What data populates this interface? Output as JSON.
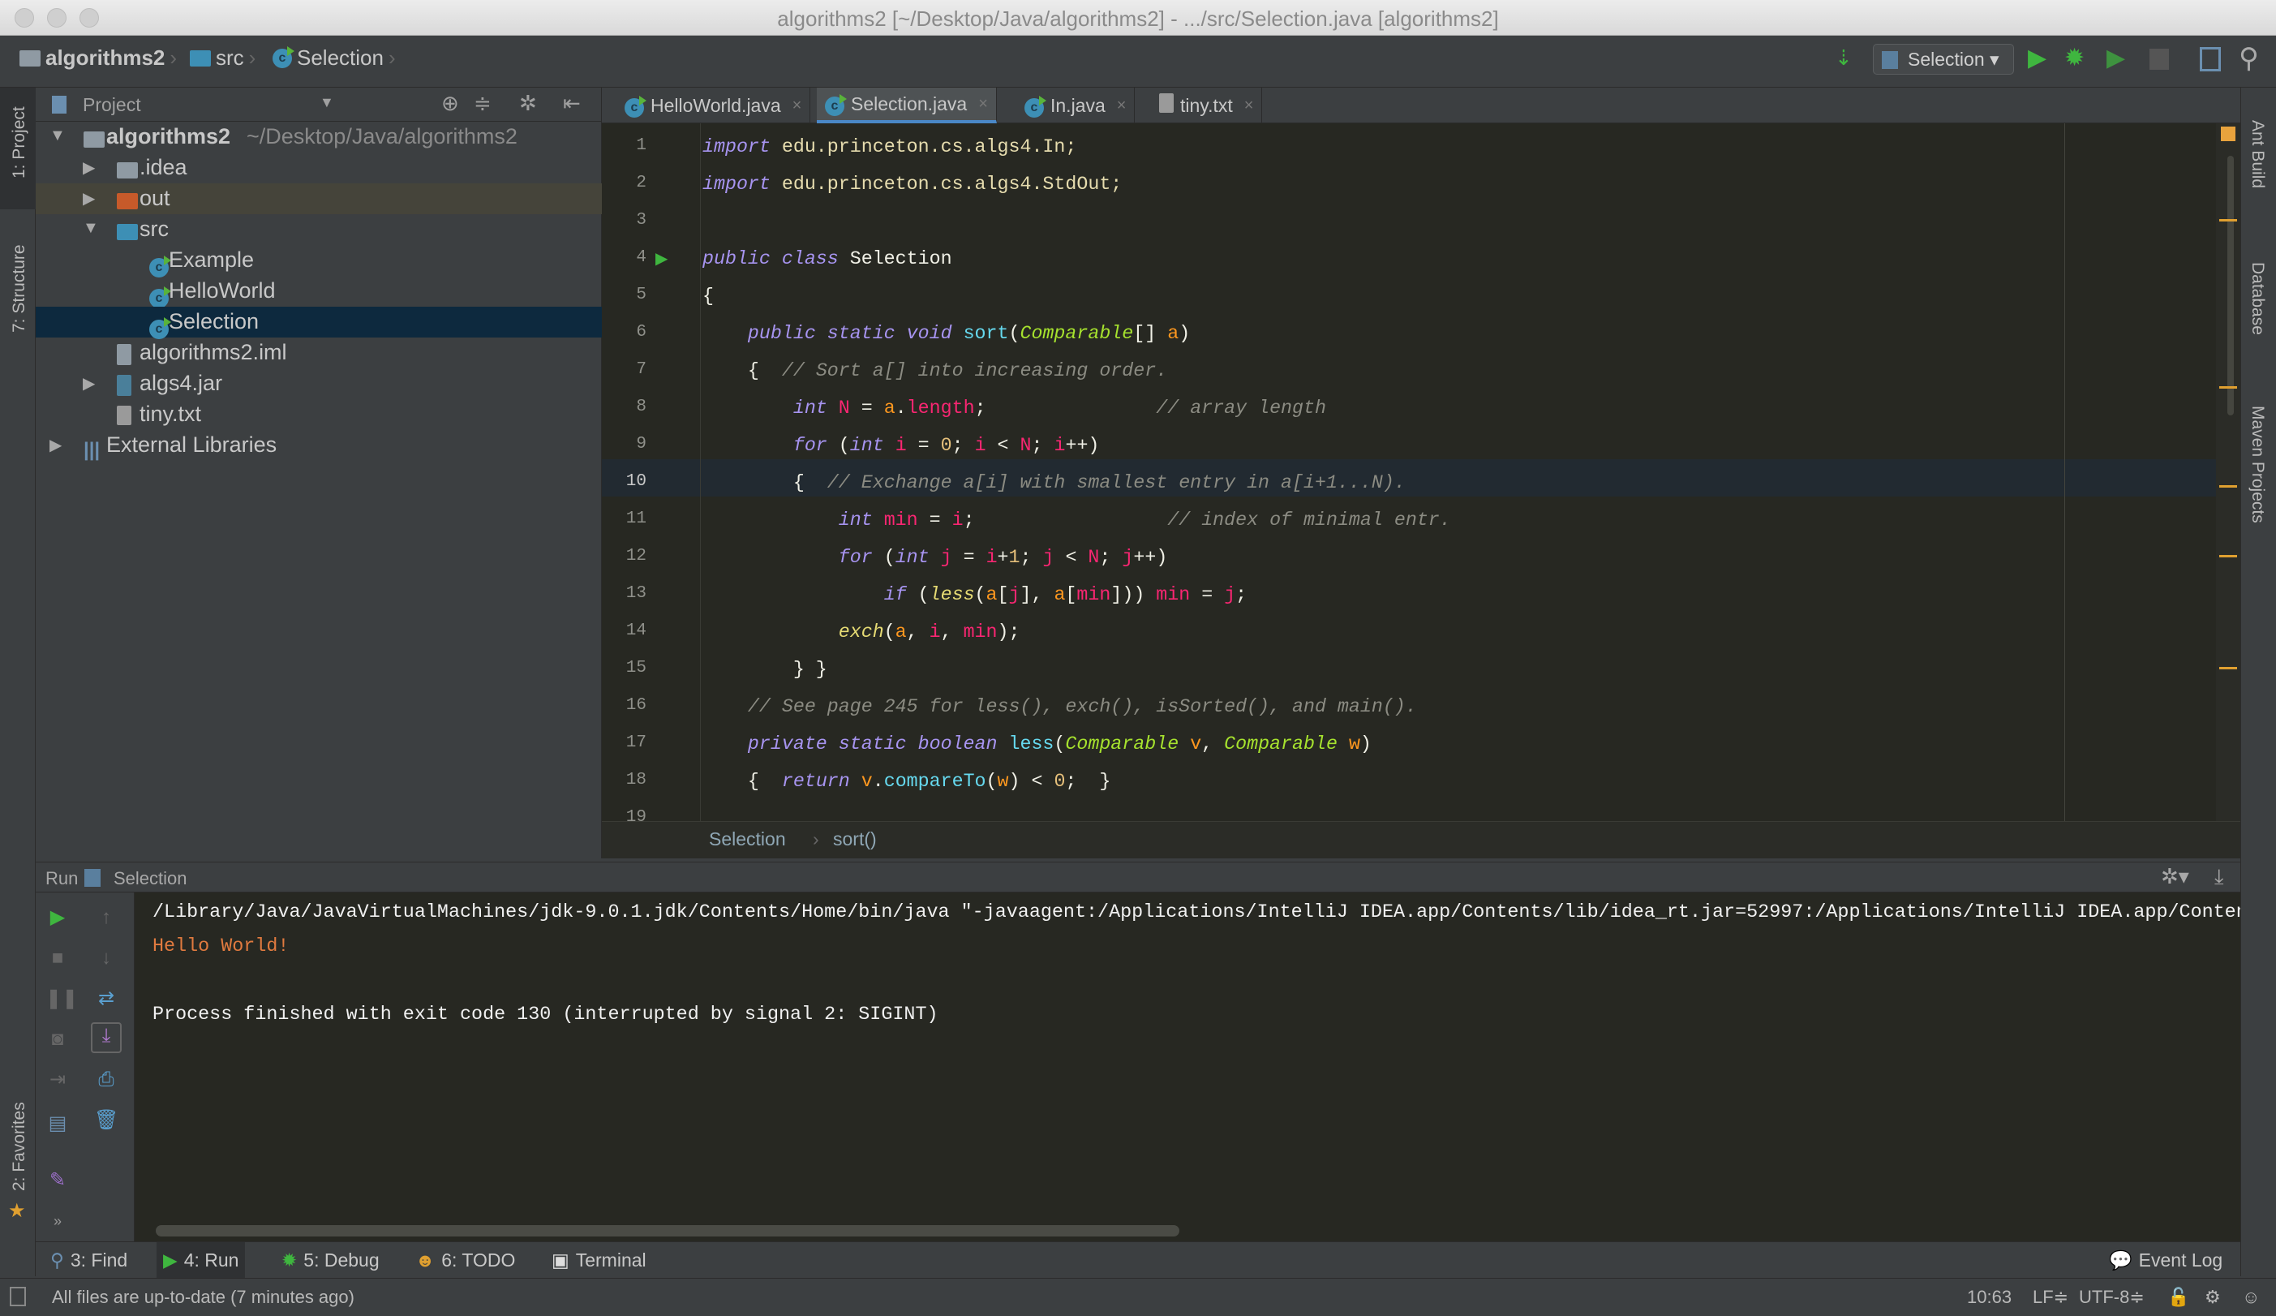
{
  "window": {
    "title": "algorithms2 [~/Desktop/Java/algorithms2] - .../src/Selection.java [algorithms2]"
  },
  "navbar": {
    "breadcrumbs": [
      "algorithms2",
      "src",
      "Selection"
    ],
    "run_config": "Selection",
    "icons": [
      "build-icon",
      "run-icon",
      "debug-icon",
      "coverage-icon",
      "stop-icon",
      "project-structure-icon",
      "search-icon"
    ]
  },
  "left_strip": {
    "project": "1: Project",
    "structure": "7: Structure",
    "favorites": "2: Favorites"
  },
  "right_strip": {
    "ant": "Ant Build",
    "database": "Database",
    "maven": "Maven Projects"
  },
  "project": {
    "header": "Project",
    "tree": [
      {
        "label": "algorithms2",
        "path": "~/Desktop/Java/algorithms2",
        "level": 0,
        "arrow": "▼",
        "icon": "module"
      },
      {
        "label": ".idea",
        "level": 1,
        "arrow": "▶",
        "icon": "folder"
      },
      {
        "label": "out",
        "level": 1,
        "arrow": "▶",
        "icon": "folder-orange"
      },
      {
        "label": "src",
        "level": 1,
        "arrow": "▼",
        "icon": "folder-blue"
      },
      {
        "label": "Example",
        "level": 2,
        "icon": "class"
      },
      {
        "label": "HelloWorld",
        "level": 2,
        "icon": "class"
      },
      {
        "label": "Selection",
        "level": 2,
        "icon": "class",
        "selected": true
      },
      {
        "label": "algorithms2.iml",
        "level": 1,
        "icon": "file"
      },
      {
        "label": "algs4.jar",
        "level": 1,
        "arrow": "▶",
        "icon": "jar"
      },
      {
        "label": "tiny.txt",
        "level": 1,
        "icon": "text"
      },
      {
        "label": "External Libraries",
        "level": 0,
        "arrow": "▶",
        "icon": "libraries"
      }
    ]
  },
  "tabs": [
    {
      "label": "HelloWorld.java",
      "icon": "class"
    },
    {
      "label": "Selection.java",
      "icon": "class",
      "active": true
    },
    {
      "label": "In.java",
      "icon": "class-locked"
    },
    {
      "label": "tiny.txt",
      "icon": "text"
    }
  ],
  "editor": {
    "current_line": 10,
    "lines": [
      [
        [
          "k",
          "import"
        ],
        [
          "pk",
          " edu.princeton.cs.algs4.In;"
        ]
      ],
      [
        [
          "k",
          "import"
        ],
        [
          "pk",
          " edu.princeton.cs.algs4.StdOut;"
        ]
      ],
      [],
      [
        [
          "k",
          "public class"
        ],
        [
          "p",
          " Selection"
        ]
      ],
      [
        [
          "p",
          "{"
        ]
      ],
      [
        [
          "p",
          "    "
        ],
        [
          "k",
          "public static void"
        ],
        [
          "p",
          " "
        ],
        [
          "m",
          "sort"
        ],
        [
          "p",
          "("
        ],
        [
          "t",
          "Comparable"
        ],
        [
          "p",
          "[] "
        ],
        [
          "a",
          "a"
        ],
        [
          "p",
          ")"
        ]
      ],
      [
        [
          "p",
          "    {  "
        ],
        [
          "c",
          "// Sort a[] into increasing order."
        ]
      ],
      [
        [
          "p",
          "        "
        ],
        [
          "k",
          "int"
        ],
        [
          "p",
          " "
        ],
        [
          "v",
          "N"
        ],
        [
          "p",
          " = "
        ],
        [
          "a",
          "a"
        ],
        [
          "p",
          "."
        ],
        [
          "v",
          "length"
        ],
        [
          "p",
          ";               "
        ],
        [
          "c",
          "// array length"
        ]
      ],
      [
        [
          "p",
          "        "
        ],
        [
          "k",
          "for"
        ],
        [
          "p",
          " ("
        ],
        [
          "k",
          "int"
        ],
        [
          "p",
          " "
        ],
        [
          "v",
          "i"
        ],
        [
          "p",
          " = "
        ],
        [
          "n",
          "0"
        ],
        [
          "p",
          "; "
        ],
        [
          "v",
          "i"
        ],
        [
          "p",
          " < "
        ],
        [
          "v",
          "N"
        ],
        [
          "p",
          "; "
        ],
        [
          "v",
          "i"
        ],
        [
          "p",
          "++)"
        ]
      ],
      [
        [
          "p",
          "        {  "
        ],
        [
          "c",
          "// Exchange a[i] with smallest entry in a[i+1...N)."
        ]
      ],
      [
        [
          "p",
          "            "
        ],
        [
          "k",
          "int"
        ],
        [
          "p",
          " "
        ],
        [
          "v",
          "min"
        ],
        [
          "p",
          " = "
        ],
        [
          "v",
          "i"
        ],
        [
          "p",
          ";                 "
        ],
        [
          "c",
          "// index of minimal entr."
        ]
      ],
      [
        [
          "p",
          "            "
        ],
        [
          "k",
          "for"
        ],
        [
          "p",
          " ("
        ],
        [
          "k",
          "int"
        ],
        [
          "p",
          " "
        ],
        [
          "v",
          "j"
        ],
        [
          "p",
          " = "
        ],
        [
          "v",
          "i"
        ],
        [
          "p",
          "+"
        ],
        [
          "n",
          "1"
        ],
        [
          "p",
          "; "
        ],
        [
          "v",
          "j"
        ],
        [
          "p",
          " < "
        ],
        [
          "v",
          "N"
        ],
        [
          "p",
          "; "
        ],
        [
          "v",
          "j"
        ],
        [
          "p",
          "++)"
        ]
      ],
      [
        [
          "p",
          "                "
        ],
        [
          "k",
          "if"
        ],
        [
          "p",
          " ("
        ],
        [
          "s",
          "less"
        ],
        [
          "p",
          "("
        ],
        [
          "a",
          "a"
        ],
        [
          "p",
          "["
        ],
        [
          "v",
          "j"
        ],
        [
          "p",
          "], "
        ],
        [
          "a",
          "a"
        ],
        [
          "p",
          "["
        ],
        [
          "v",
          "min"
        ],
        [
          "p",
          "])) "
        ],
        [
          "v",
          "min"
        ],
        [
          "p",
          " = "
        ],
        [
          "v",
          "j"
        ],
        [
          "p",
          ";"
        ]
      ],
      [
        [
          "p",
          "            "
        ],
        [
          "s",
          "exch"
        ],
        [
          "p",
          "("
        ],
        [
          "a",
          "a"
        ],
        [
          "p",
          ", "
        ],
        [
          "v",
          "i"
        ],
        [
          "p",
          ", "
        ],
        [
          "v",
          "min"
        ],
        [
          "p",
          ");"
        ]
      ],
      [
        [
          "p",
          "        } }"
        ]
      ],
      [
        [
          "p",
          "    "
        ],
        [
          "c",
          "// See page 245 for less(), exch(), isSorted(), and main()."
        ]
      ],
      [
        [
          "p",
          "    "
        ],
        [
          "k",
          "private static boolean"
        ],
        [
          "p",
          " "
        ],
        [
          "m",
          "less"
        ],
        [
          "p",
          "("
        ],
        [
          "t",
          "Comparable"
        ],
        [
          "p",
          " "
        ],
        [
          "a",
          "v"
        ],
        [
          "p",
          ", "
        ],
        [
          "t",
          "Comparable"
        ],
        [
          "p",
          " "
        ],
        [
          "a",
          "w"
        ],
        [
          "p",
          ")"
        ]
      ],
      [
        [
          "p",
          "    {  "
        ],
        [
          "k",
          "return"
        ],
        [
          "p",
          " "
        ],
        [
          "a",
          "v"
        ],
        [
          "p",
          "."
        ],
        [
          "m",
          "compareTo"
        ],
        [
          "p",
          "("
        ],
        [
          "a",
          "w"
        ],
        [
          "p",
          ") < "
        ],
        [
          "n",
          "0"
        ],
        [
          "p",
          ";  }"
        ]
      ],
      []
    ],
    "breadcrumb": [
      "Selection",
      "sort()"
    ]
  },
  "run": {
    "label": "Run",
    "config": "Selection",
    "console": [
      {
        "text": "/Library/Java/JavaVirtualMachines/jdk-9.0.1.jdk/Contents/Home/bin/java \"-javaagent:/Applications/IntelliJ IDEA.app/Contents/lib/idea_rt.jar=52997:/Applications/IntelliJ IDEA.app/Conten",
        "color": "#f0f0f0"
      },
      {
        "text": "Hello World!",
        "color": "#e07a3f"
      },
      {
        "text": "",
        "color": "#f0f0f0"
      },
      {
        "text": "Process finished with exit code 130 (interrupted by signal 2: SIGINT)",
        "color": "#f0f0f0"
      }
    ]
  },
  "bottom_tools": [
    {
      "label": "3: Find",
      "icon": "search-icon"
    },
    {
      "label": "4: Run",
      "icon": "run-icon",
      "selected": true
    },
    {
      "label": "5: Debug",
      "icon": "debug-icon"
    },
    {
      "label": "6: TODO",
      "icon": "todo-icon"
    },
    {
      "label": "Terminal",
      "icon": "terminal-icon"
    }
  ],
  "event_log": "Event Log",
  "status": {
    "message": "All files are up-to-date (7 minutes ago)",
    "position": "10:63",
    "line_sep": "LF≑",
    "encoding": "UTF-8≑"
  },
  "colors": {
    "accent": "#4a88c7",
    "editor_bg": "#272822",
    "selection": "#0d293e",
    "run_green": "#3fb63f"
  }
}
